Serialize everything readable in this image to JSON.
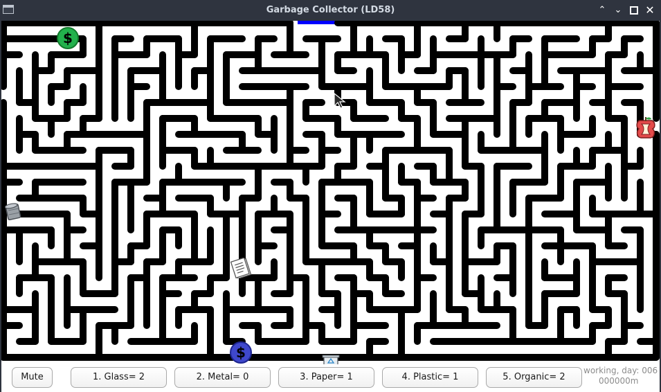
{
  "window": {
    "title": "Garbage Collector (LD58)",
    "controls": [
      "chevron-up-icon",
      "chevron-down-icon",
      "maximize-icon",
      "close-icon"
    ]
  },
  "game": {
    "pickups": [
      {
        "name": "coin-green",
        "type": "coin",
        "symbol": "$",
        "color": "#22b14c"
      },
      {
        "name": "coin-blue",
        "type": "coin",
        "symbol": "$",
        "color": "#3f48cc"
      },
      {
        "name": "apple-core",
        "type": "organic-waste"
      },
      {
        "name": "tin-can",
        "type": "metal-waste"
      },
      {
        "name": "paper-stack",
        "type": "paper-waste"
      },
      {
        "name": "recycle-bin",
        "type": "recycle-bin"
      }
    ],
    "exit_color": "#0000ff"
  },
  "hud": {
    "mute_label": "Mute",
    "glass_label": "1. Glass= 2",
    "metal_label": "2. Metal= 0",
    "paper_label": "3. Paper= 1",
    "plastic_label": "4. Plastic= 1",
    "organic_label": "5. Organic= 2",
    "status_line1": "working, day: 006",
    "status_line2": "000000m"
  }
}
